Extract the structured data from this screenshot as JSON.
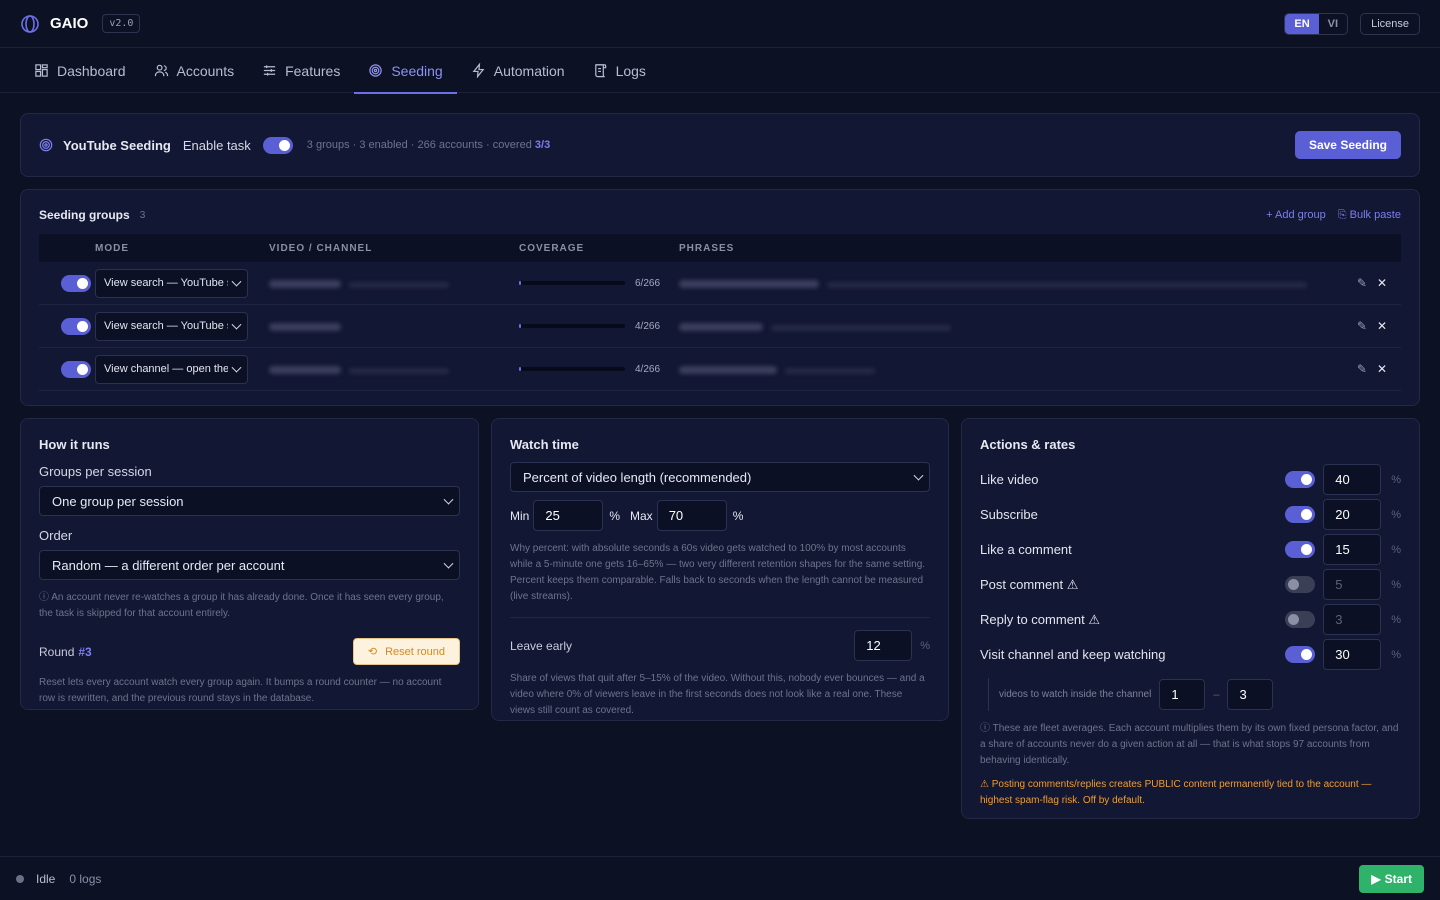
{
  "app": {
    "title": "GAIO",
    "version": "v2.0"
  },
  "lang": {
    "en": "EN",
    "vi": "VI"
  },
  "license_label": "License",
  "nav": [
    {
      "label": "Dashboard",
      "icon": "grid-icon"
    },
    {
      "label": "Accounts",
      "icon": "users-icon"
    },
    {
      "label": "Features",
      "icon": "sliders-icon"
    },
    {
      "label": "Seeding",
      "icon": "target-icon",
      "active": true
    },
    {
      "label": "Automation",
      "icon": "bolt-icon"
    },
    {
      "label": "Logs",
      "icon": "scroll-icon"
    }
  ],
  "task": {
    "title": "YouTube Seeding",
    "enable_label": "Enable task",
    "summary_prefix": "3 groups · 3 enabled · 266 accounts · covered",
    "summary_covered": "3/3",
    "save_label": "Save Seeding"
  },
  "groups": {
    "title": "Seeding groups",
    "count": "3",
    "add_label": "+ Add group",
    "bulk_label": "⎘ Bulk paste",
    "columns": {
      "mode": "MODE",
      "video": "VIDEO / CHANNEL",
      "coverage": "COVERAGE",
      "phrases": "PHRASES"
    },
    "rows": [
      {
        "mode": "View search — YouTube search",
        "coverage": "6/266",
        "progress": 0.023
      },
      {
        "mode": "View search — YouTube search",
        "coverage": "4/266",
        "progress": 0.015
      },
      {
        "mode": "View channel — open the channel",
        "coverage": "4/266",
        "progress": 0.015
      }
    ]
  },
  "how": {
    "title": "How it runs",
    "groups_label": "Groups per session",
    "groups_value": "One group per session",
    "order_label": "Order",
    "order_value": "Random — a different order per account",
    "note": "ⓘ An account never re-watches a group it has already done. Once it has seen every group, the task is skipped for that account entirely.",
    "round_label": "Round",
    "round_num": "#3",
    "reset_label": "Reset round",
    "reset_note": "Reset lets every account watch every group again. It bumps a round counter — no account row is rewritten, and the previous round stays in the database."
  },
  "watch": {
    "title": "Watch time",
    "mode_value": "Percent of video length (recommended)",
    "min_label": "Min",
    "min_value": "25",
    "max_label": "Max",
    "max_value": "70",
    "pct": "%",
    "note": "Why percent: with absolute seconds a 60s video gets watched to 100% by most accounts while a 5-minute one gets 16–65% — two very different retention shapes for the same setting. Percent keeps them comparable. Falls back to seconds when the length cannot be measured (live streams).",
    "leave_label": "Leave early",
    "leave_value": "12",
    "leave_note": "Share of views that quit after 5–15% of the video. Without this, nobody ever bounces — and a video where 0% of viewers leave in the first seconds does not look like a real one. These views still count as covered."
  },
  "actions": {
    "title": "Actions & rates",
    "items": [
      {
        "label": "Like video",
        "on": true,
        "value": "40"
      },
      {
        "label": "Subscribe",
        "on": true,
        "value": "20"
      },
      {
        "label": "Like a comment",
        "on": true,
        "value": "15"
      },
      {
        "label": "Post comment ⚠",
        "on": false,
        "value": "5"
      },
      {
        "label": "Reply to comment ⚠",
        "on": false,
        "value": "3"
      },
      {
        "label": "Visit channel and keep watching",
        "on": true,
        "value": "30"
      }
    ],
    "pct": "%",
    "sub_label": "videos to watch inside the channel",
    "sub_min": "1",
    "sub_sep": "–",
    "sub_max": "3",
    "note": "ⓘ These are fleet averages. Each account multiplies them by its own fixed persona factor, and a share of accounts never do a given action at all — that is what stops 97 accounts from behaving identically.",
    "warning": "⚠ Posting comments/replies creates PUBLIC content permanently tied to the account — highest spam-flag risk. Off by default."
  },
  "footer": {
    "status": "Idle",
    "logs": "0 logs",
    "start_label": "Start"
  }
}
